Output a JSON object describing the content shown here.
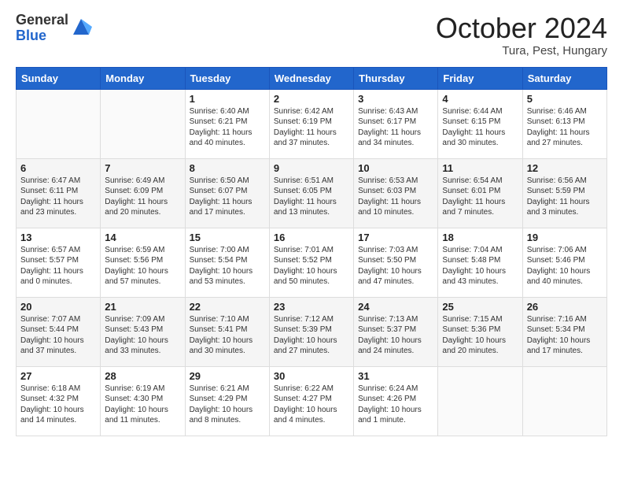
{
  "header": {
    "logo_general": "General",
    "logo_blue": "Blue",
    "month_title": "October 2024",
    "location": "Tura, Pest, Hungary"
  },
  "days_of_week": [
    "Sunday",
    "Monday",
    "Tuesday",
    "Wednesday",
    "Thursday",
    "Friday",
    "Saturday"
  ],
  "weeks": [
    [
      {
        "day": "",
        "sunrise": "",
        "sunset": "",
        "daylight": ""
      },
      {
        "day": "",
        "sunrise": "",
        "sunset": "",
        "daylight": ""
      },
      {
        "day": "1",
        "sunrise": "Sunrise: 6:40 AM",
        "sunset": "Sunset: 6:21 PM",
        "daylight": "Daylight: 11 hours and 40 minutes."
      },
      {
        "day": "2",
        "sunrise": "Sunrise: 6:42 AM",
        "sunset": "Sunset: 6:19 PM",
        "daylight": "Daylight: 11 hours and 37 minutes."
      },
      {
        "day": "3",
        "sunrise": "Sunrise: 6:43 AM",
        "sunset": "Sunset: 6:17 PM",
        "daylight": "Daylight: 11 hours and 34 minutes."
      },
      {
        "day": "4",
        "sunrise": "Sunrise: 6:44 AM",
        "sunset": "Sunset: 6:15 PM",
        "daylight": "Daylight: 11 hours and 30 minutes."
      },
      {
        "day": "5",
        "sunrise": "Sunrise: 6:46 AM",
        "sunset": "Sunset: 6:13 PM",
        "daylight": "Daylight: 11 hours and 27 minutes."
      }
    ],
    [
      {
        "day": "6",
        "sunrise": "Sunrise: 6:47 AM",
        "sunset": "Sunset: 6:11 PM",
        "daylight": "Daylight: 11 hours and 23 minutes."
      },
      {
        "day": "7",
        "sunrise": "Sunrise: 6:49 AM",
        "sunset": "Sunset: 6:09 PM",
        "daylight": "Daylight: 11 hours and 20 minutes."
      },
      {
        "day": "8",
        "sunrise": "Sunrise: 6:50 AM",
        "sunset": "Sunset: 6:07 PM",
        "daylight": "Daylight: 11 hours and 17 minutes."
      },
      {
        "day": "9",
        "sunrise": "Sunrise: 6:51 AM",
        "sunset": "Sunset: 6:05 PM",
        "daylight": "Daylight: 11 hours and 13 minutes."
      },
      {
        "day": "10",
        "sunrise": "Sunrise: 6:53 AM",
        "sunset": "Sunset: 6:03 PM",
        "daylight": "Daylight: 11 hours and 10 minutes."
      },
      {
        "day": "11",
        "sunrise": "Sunrise: 6:54 AM",
        "sunset": "Sunset: 6:01 PM",
        "daylight": "Daylight: 11 hours and 7 minutes."
      },
      {
        "day": "12",
        "sunrise": "Sunrise: 6:56 AM",
        "sunset": "Sunset: 5:59 PM",
        "daylight": "Daylight: 11 hours and 3 minutes."
      }
    ],
    [
      {
        "day": "13",
        "sunrise": "Sunrise: 6:57 AM",
        "sunset": "Sunset: 5:57 PM",
        "daylight": "Daylight: 11 hours and 0 minutes."
      },
      {
        "day": "14",
        "sunrise": "Sunrise: 6:59 AM",
        "sunset": "Sunset: 5:56 PM",
        "daylight": "Daylight: 10 hours and 57 minutes."
      },
      {
        "day": "15",
        "sunrise": "Sunrise: 7:00 AM",
        "sunset": "Sunset: 5:54 PM",
        "daylight": "Daylight: 10 hours and 53 minutes."
      },
      {
        "day": "16",
        "sunrise": "Sunrise: 7:01 AM",
        "sunset": "Sunset: 5:52 PM",
        "daylight": "Daylight: 10 hours and 50 minutes."
      },
      {
        "day": "17",
        "sunrise": "Sunrise: 7:03 AM",
        "sunset": "Sunset: 5:50 PM",
        "daylight": "Daylight: 10 hours and 47 minutes."
      },
      {
        "day": "18",
        "sunrise": "Sunrise: 7:04 AM",
        "sunset": "Sunset: 5:48 PM",
        "daylight": "Daylight: 10 hours and 43 minutes."
      },
      {
        "day": "19",
        "sunrise": "Sunrise: 7:06 AM",
        "sunset": "Sunset: 5:46 PM",
        "daylight": "Daylight: 10 hours and 40 minutes."
      }
    ],
    [
      {
        "day": "20",
        "sunrise": "Sunrise: 7:07 AM",
        "sunset": "Sunset: 5:44 PM",
        "daylight": "Daylight: 10 hours and 37 minutes."
      },
      {
        "day": "21",
        "sunrise": "Sunrise: 7:09 AM",
        "sunset": "Sunset: 5:43 PM",
        "daylight": "Daylight: 10 hours and 33 minutes."
      },
      {
        "day": "22",
        "sunrise": "Sunrise: 7:10 AM",
        "sunset": "Sunset: 5:41 PM",
        "daylight": "Daylight: 10 hours and 30 minutes."
      },
      {
        "day": "23",
        "sunrise": "Sunrise: 7:12 AM",
        "sunset": "Sunset: 5:39 PM",
        "daylight": "Daylight: 10 hours and 27 minutes."
      },
      {
        "day": "24",
        "sunrise": "Sunrise: 7:13 AM",
        "sunset": "Sunset: 5:37 PM",
        "daylight": "Daylight: 10 hours and 24 minutes."
      },
      {
        "day": "25",
        "sunrise": "Sunrise: 7:15 AM",
        "sunset": "Sunset: 5:36 PM",
        "daylight": "Daylight: 10 hours and 20 minutes."
      },
      {
        "day": "26",
        "sunrise": "Sunrise: 7:16 AM",
        "sunset": "Sunset: 5:34 PM",
        "daylight": "Daylight: 10 hours and 17 minutes."
      }
    ],
    [
      {
        "day": "27",
        "sunrise": "Sunrise: 6:18 AM",
        "sunset": "Sunset: 4:32 PM",
        "daylight": "Daylight: 10 hours and 14 minutes."
      },
      {
        "day": "28",
        "sunrise": "Sunrise: 6:19 AM",
        "sunset": "Sunset: 4:30 PM",
        "daylight": "Daylight: 10 hours and 11 minutes."
      },
      {
        "day": "29",
        "sunrise": "Sunrise: 6:21 AM",
        "sunset": "Sunset: 4:29 PM",
        "daylight": "Daylight: 10 hours and 8 minutes."
      },
      {
        "day": "30",
        "sunrise": "Sunrise: 6:22 AM",
        "sunset": "Sunset: 4:27 PM",
        "daylight": "Daylight: 10 hours and 4 minutes."
      },
      {
        "day": "31",
        "sunrise": "Sunrise: 6:24 AM",
        "sunset": "Sunset: 4:26 PM",
        "daylight": "Daylight: 10 hours and 1 minute."
      },
      {
        "day": "",
        "sunrise": "",
        "sunset": "",
        "daylight": ""
      },
      {
        "day": "",
        "sunrise": "",
        "sunset": "",
        "daylight": ""
      }
    ]
  ]
}
